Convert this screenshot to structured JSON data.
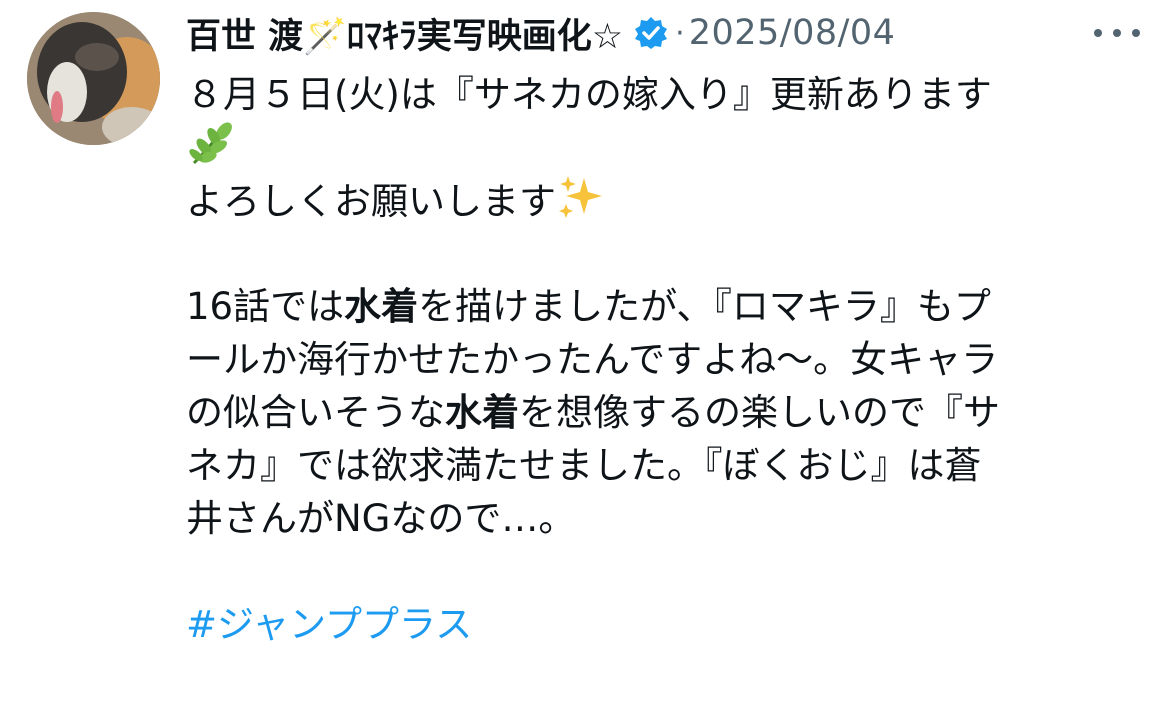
{
  "post": {
    "author": {
      "display_name": "百世 渡🪄ﾛﾏｷﾗ実写映画化☆",
      "verified": true
    },
    "separator": "·",
    "date": "2025/08/04",
    "more_icon": "ellipsis-icon",
    "lines": {
      "l1": "８月５日(火)は『サネカの嫁入り』更新あります",
      "l2_emoji": "herb-emoji",
      "l3_text": "よろしくお願いします",
      "l3_emoji": "sparkles-emoji",
      "l4_a": "16話では",
      "l4_b": "水着",
      "l4_c": "を描けましたが、『ロマキラ』もプ",
      "l5": "ールか海行かせたかったんですよね〜。女キャラ",
      "l6_a": "の似合いそうな",
      "l6_b": "水着",
      "l6_c": "を想像するの楽しいので『サ",
      "l7": "ネカ』では欲求満たせました。『ぼくおじ』は蒼",
      "l8": "井さんがNGなので…。"
    },
    "hashtag": "#ジャンププラス"
  },
  "colors": {
    "text": "#0f1419",
    "muted": "#536471",
    "link": "#1d9bf0",
    "verified": "#1d9bf0"
  }
}
